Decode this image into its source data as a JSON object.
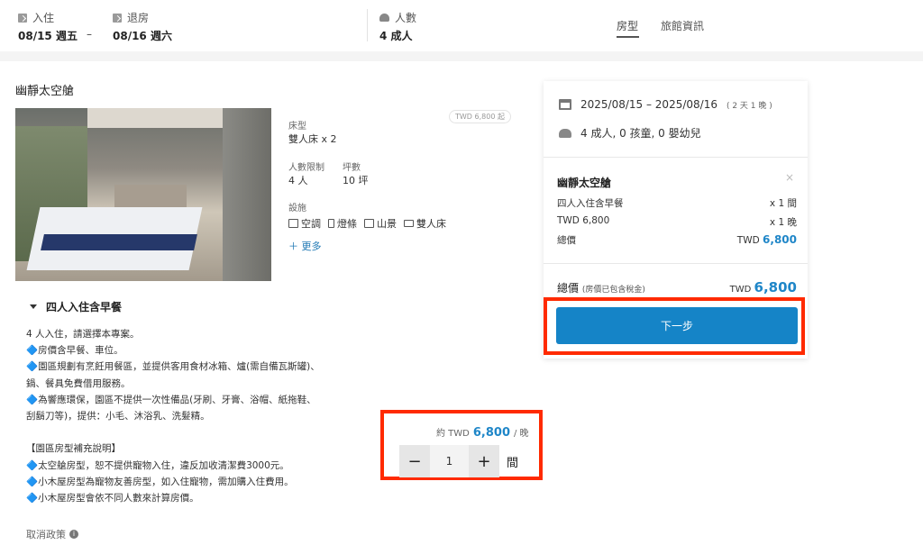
{
  "header": {
    "checkin_label": "入住",
    "checkin_value": "08/15 週五",
    "dash": "–",
    "checkout_label": "退房",
    "checkout_value": "08/16 週六",
    "guests_label": "人數",
    "guests_value": "4 成人",
    "tabs": [
      {
        "label": "房型",
        "active": true
      },
      {
        "label": "旅館資訊",
        "active": false
      }
    ]
  },
  "room": {
    "title": "幽靜太空艙",
    "price_tag": "TWD 6,800 起",
    "bed_type_label": "床型",
    "bed_type_value": "雙人床 x 2",
    "capacity_label": "人數限制",
    "capacity_value": "4 人",
    "area_label": "坪數",
    "area_value": "10 坪",
    "facilities_label": "設施",
    "amenities": [
      {
        "icon": "air-conditioner-icon",
        "label": "空調"
      },
      {
        "icon": "lamp-icon",
        "label": "燈條"
      },
      {
        "icon": "scenery-icon",
        "label": "山景"
      },
      {
        "icon": "double-bed-icon",
        "label": "雙人床"
      }
    ],
    "more_label": "更多"
  },
  "plan": {
    "title": "四人入住含早餐",
    "description": [
      "4 人入住，請選擇本專案。",
      "🔷房價含早餐、車位。",
      "🔷園區規劃有烹飪用餐區，並提供客用食材冰箱、爐(需自備瓦斯罐)、",
      "鍋、餐具免費借用服務。",
      "🔷為響應環保，園區不提供一次性備品(牙刷、牙膏、浴帽、紙拖鞋、",
      "刮鬍刀等)，提供：小毛、沐浴乳、洗髮精。",
      "",
      "【園區房型補充說明】",
      "🔷太空艙房型，恕不提供寵物入住，違反加收清潔費3000元。",
      "🔷小木屋房型為寵物友善房型，如入住寵物，需加購入住費用。",
      "🔷小木屋房型會依不同人數來計算房價。"
    ],
    "cancel_policy": "取消政策",
    "price_prefix": "約 TWD",
    "price_value": "6,800",
    "price_suffix": "/ 晚",
    "quantity": "1",
    "unit": "間",
    "minus": "−",
    "plus": "+"
  },
  "summary": {
    "dates": "2025/08/15 – 2025/08/16",
    "nights": "( 2 天 1 晚 )",
    "guests": "4 成人, 0 孩童, 0 嬰幼兒",
    "room_name": "幽靜太空艙",
    "close": "×",
    "plan_name": "四人入住含早餐",
    "plan_qty": "x 1 間",
    "rate": "TWD 6,800",
    "rate_qty": "x 1 晚",
    "subtotal_label": "總價",
    "subtotal_currency": "TWD",
    "subtotal_value": "6,800",
    "total_label": "總價",
    "total_note": "(房價已包含稅金)",
    "total_currency": "TWD",
    "total_value": "6,800",
    "next_button": "下一步"
  },
  "colors": {
    "accent": "#1584c7",
    "price": "#1f86c8",
    "highlight": "#ff2a00"
  }
}
